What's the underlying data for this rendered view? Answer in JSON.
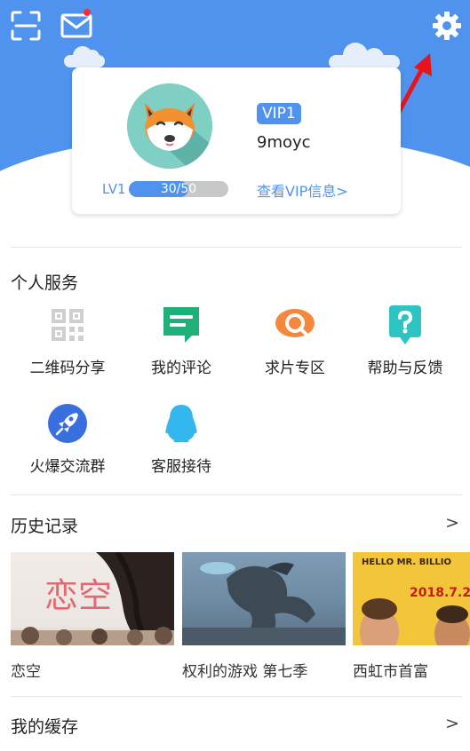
{
  "header": {
    "icons": [
      "scan-icon",
      "mail-icon",
      "settings-icon"
    ],
    "has_unread_mail": true,
    "accent_color": "#4f93ee"
  },
  "profile": {
    "vip_label": "VIP1",
    "username": "9moyc",
    "level_label": "LV1",
    "level_progress_text": "30/50",
    "level_progress": 0.6,
    "vip_info_link": "查看VIP信息>"
  },
  "services": {
    "title": "个人服务",
    "items": [
      {
        "label": "二维码分享",
        "icon": "qr-code-icon"
      },
      {
        "label": "我的评论",
        "icon": "comment-icon"
      },
      {
        "label": "求片专区",
        "icon": "search-movie-icon"
      },
      {
        "label": "帮助与反馈",
        "icon": "help-feedback-icon"
      },
      {
        "label": "火爆交流群",
        "icon": "rocket-icon"
      },
      {
        "label": "客服接待",
        "icon": "qq-penguin-icon"
      }
    ]
  },
  "history": {
    "title": "历史记录",
    "more": ">",
    "items": [
      {
        "title": "恋空",
        "poster_text": "恋空"
      },
      {
        "title": "权利的游戏 第七季",
        "poster_text": ""
      },
      {
        "title": "西虹市首富",
        "poster_text": "HELLO MR. BILLIO",
        "poster_date": "2018.7.2"
      }
    ]
  },
  "cache": {
    "title": "我的缓存",
    "more": ">"
  }
}
